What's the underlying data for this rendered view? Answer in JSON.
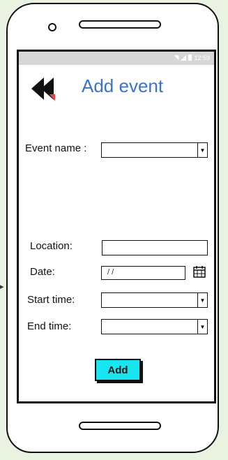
{
  "status": {
    "time": "12:59"
  },
  "header": {
    "title": "Add event"
  },
  "form": {
    "event_name_label": "Event name :",
    "location_label": "Location:",
    "date_label": "Date:",
    "date_placeholder": "/ /",
    "start_time_label": "Start time:",
    "end_time_label": "End time:"
  },
  "actions": {
    "add_label": "Add"
  },
  "colors": {
    "title": "#3a73c9",
    "add_button": "#18e6f0",
    "status_bar": "#d6d6d6"
  }
}
